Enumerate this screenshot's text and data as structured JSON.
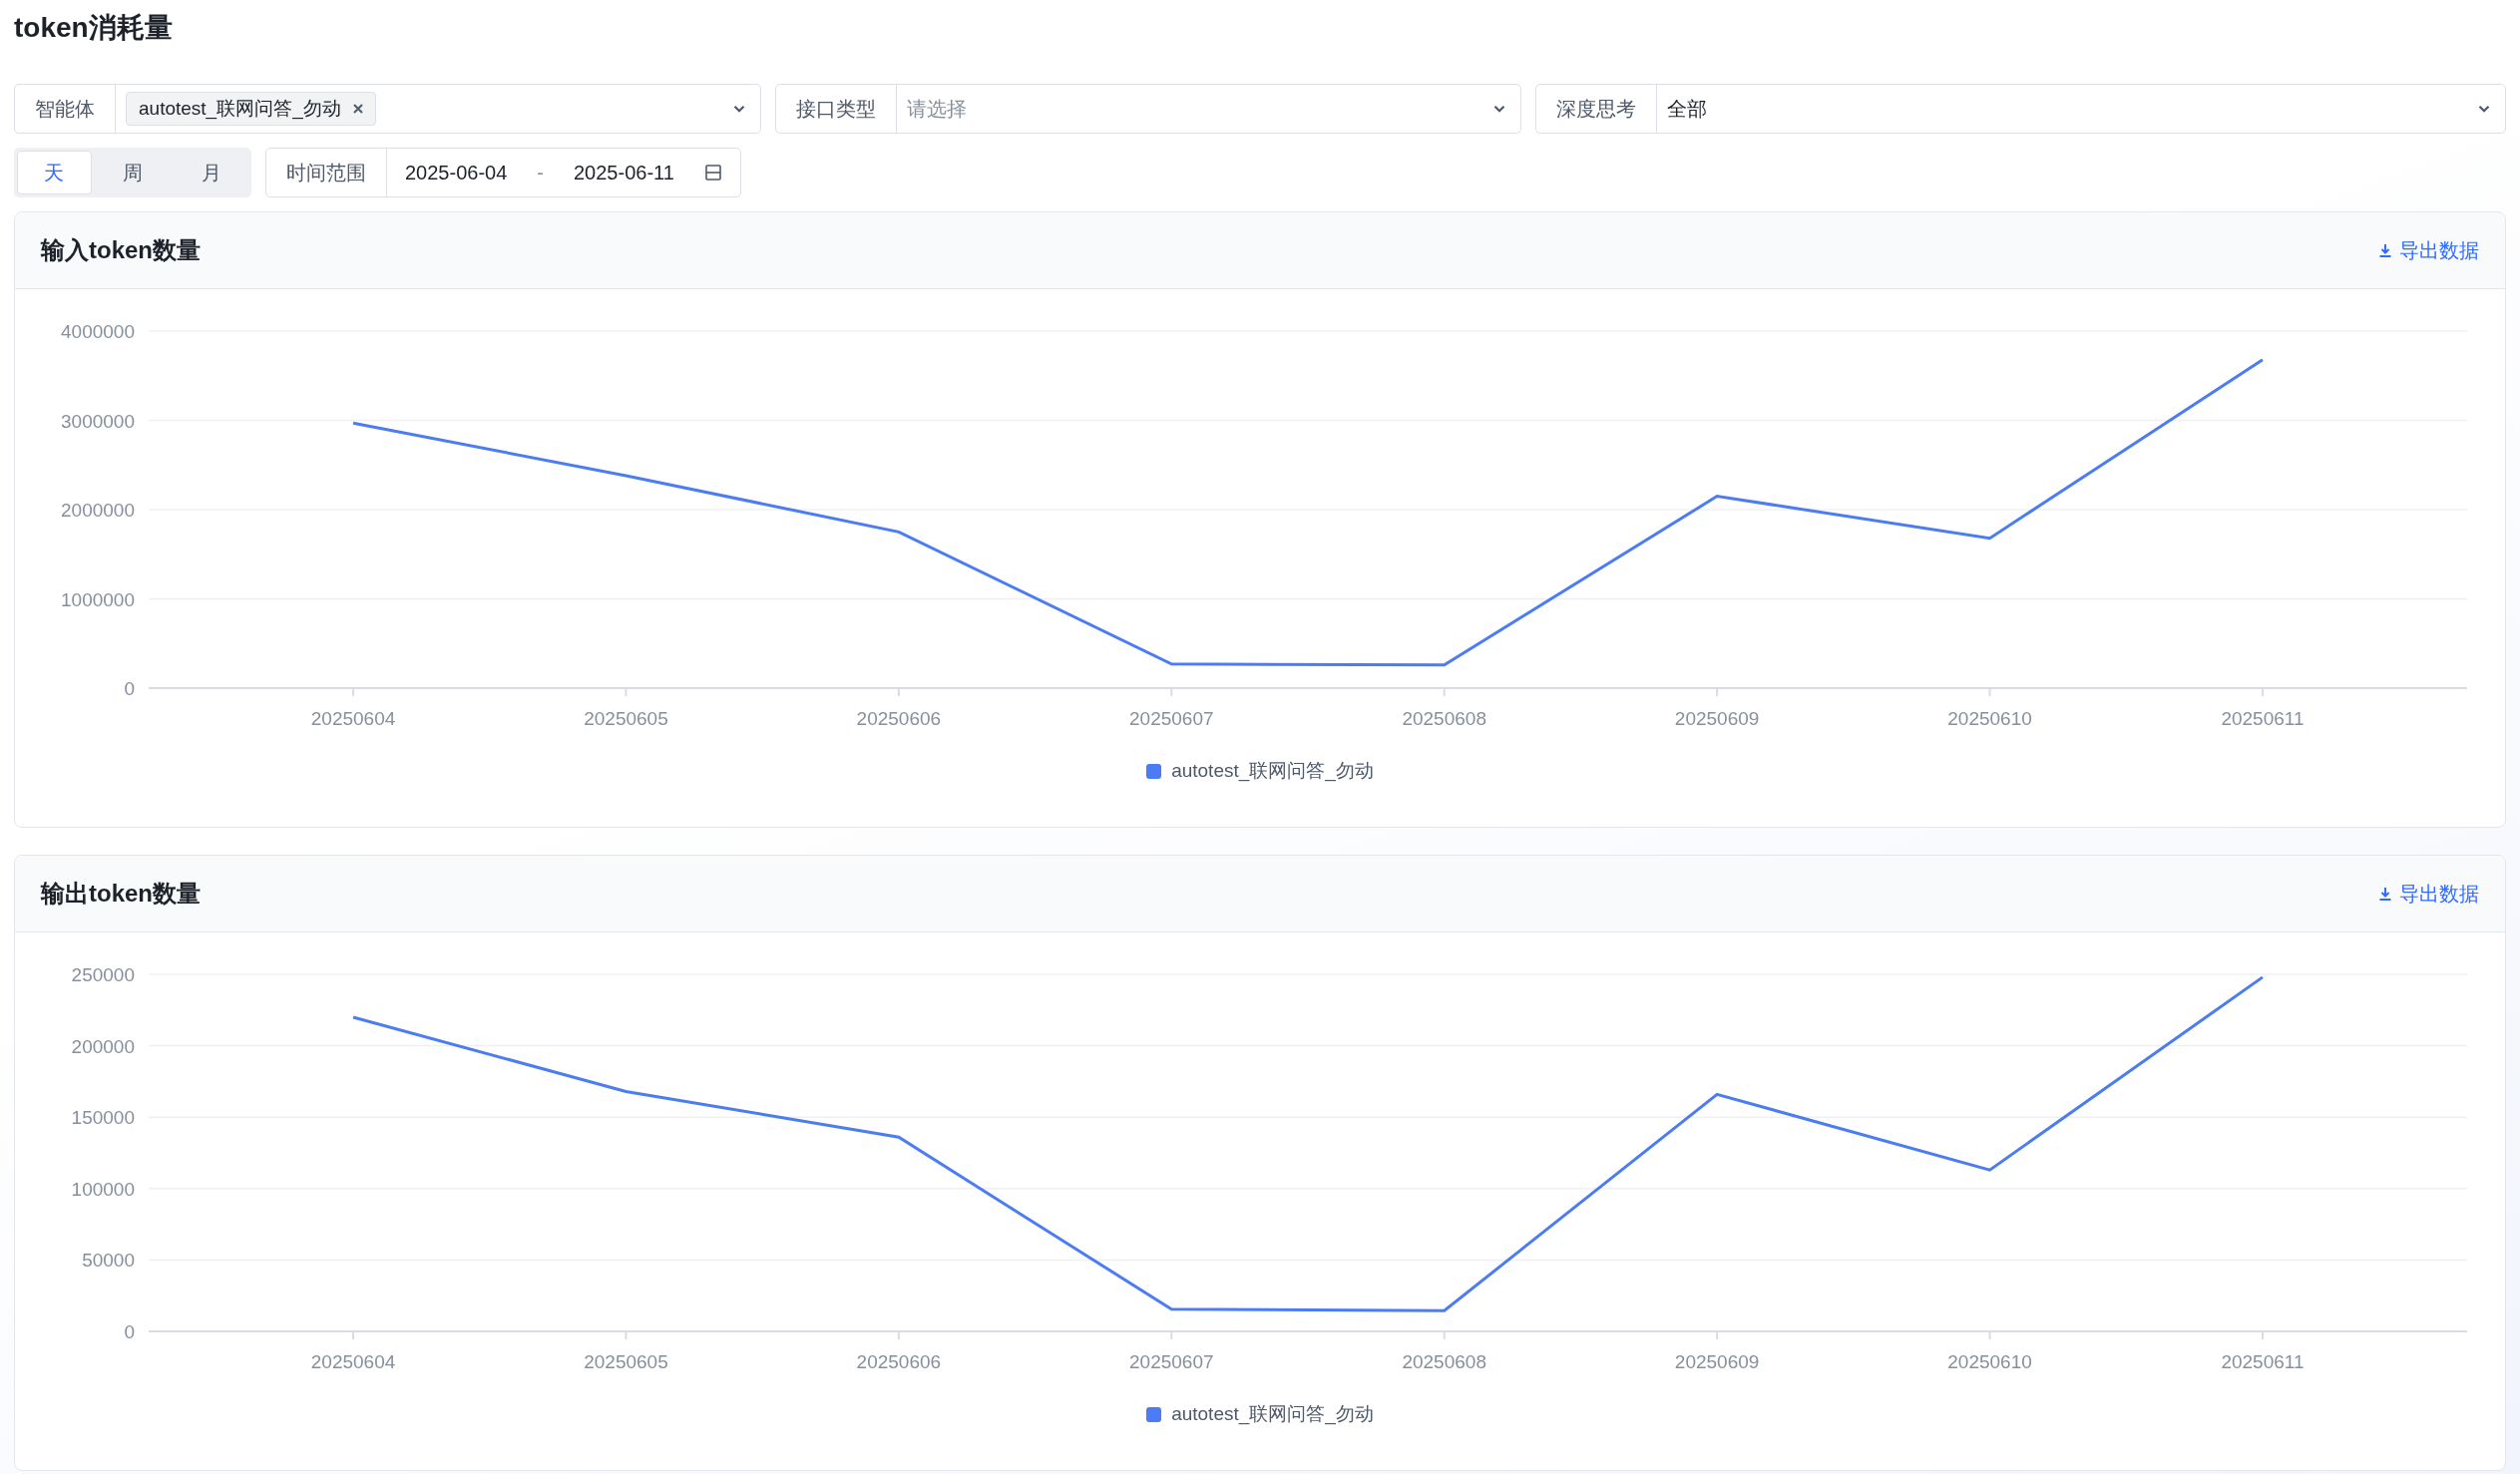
{
  "page_title": "token消耗量",
  "filters": [
    {
      "kind": "tags",
      "label": "智能体",
      "tags": [
        "autotest_联网问答_勿动"
      ]
    },
    {
      "kind": "placeholder",
      "label": "接口类型",
      "placeholder": "请选择"
    },
    {
      "kind": "value",
      "label": "深度思考",
      "value": "全部"
    }
  ],
  "period_tabs": [
    {
      "label": "天",
      "selected": true
    },
    {
      "label": "周",
      "selected": false
    },
    {
      "label": "月",
      "selected": false
    }
  ],
  "date_range": {
    "label": "时间范围",
    "start": "2025-06-04",
    "separator": "-",
    "end": "2025-06-11"
  },
  "cards": [
    {
      "title": "输入token数量",
      "export_label": "导出数据",
      "chart_data": {
        "type": "line",
        "grid": true,
        "categories": [
          "20250604",
          "20250605",
          "20250606",
          "20250607",
          "20250608",
          "20250609",
          "20250610",
          "20250611"
        ],
        "ylim": [
          0,
          4000000
        ],
        "yticks": [
          0,
          1000000,
          2000000,
          3000000,
          4000000
        ],
        "series": [
          {
            "name": "autotest_联网问答_勿动",
            "color": "#4b7cf6",
            "values": [
              2970000,
              2380000,
              1750000,
              270000,
              260000,
              2150000,
              1680000,
              3680000
            ]
          }
        ]
      }
    },
    {
      "title": "输出token数量",
      "export_label": "导出数据",
      "chart_data": {
        "type": "line",
        "grid": true,
        "categories": [
          "20250604",
          "20250605",
          "20250606",
          "20250607",
          "20250608",
          "20250609",
          "20250610",
          "20250611"
        ],
        "ylim": [
          0,
          250000
        ],
        "yticks": [
          0,
          50000,
          100000,
          150000,
          200000,
          250000
        ],
        "series": [
          {
            "name": "autotest_联网问答_勿动",
            "color": "#4b7cf6",
            "values": [
              220000,
              168000,
              136000,
              15500,
              14500,
              166000,
              113000,
              248000
            ]
          }
        ]
      }
    }
  ]
}
